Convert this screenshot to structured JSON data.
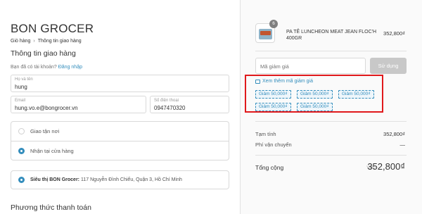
{
  "brand": "BON GROCER",
  "breadcrumb": {
    "cart": "Giỏ hàng",
    "separator": "›",
    "current": "Thông tin giao hàng"
  },
  "shipping": {
    "title": "Thông tin giao hàng",
    "have_account": "Bạn đã có tài khoản?",
    "login_link": "Đăng nhập",
    "name_label": "Họ và tên",
    "name_value": "hung",
    "email_label": "Email",
    "email_value": "hung.vo.e@bongrocer.vn",
    "phone_label": "Số điện thoại",
    "phone_value": "0947470320"
  },
  "delivery": {
    "options": [
      {
        "label": "Giao tận nơi",
        "selected": false
      },
      {
        "label": "Nhận tại cửa hàng",
        "selected": true
      }
    ],
    "store_name": "Siêu thị BON Grocer:",
    "store_address": "117 Nguyễn Đình Chiểu, Quận 3, Hồ Chí Minh"
  },
  "payment": {
    "title": "Phương thức thanh toán"
  },
  "order": {
    "product_name": "PA TÊ LUNCHEON MEAT JEAN FLOC'H 400GR",
    "product_qty": "6",
    "product_price": "352,800₫",
    "coupon_placeholder": "Mã giảm giá",
    "coupon_button": "Sử dụng",
    "view_more": "Xem thêm mã giảm giá",
    "coupons": [
      "Giảm 50,000₫",
      "Giảm 50,000₫",
      "Giảm 50,000₫",
      "Giảm 50,000₫",
      "Giảm 50,000₫"
    ],
    "subtotal_label": "Tạm tính",
    "subtotal_value": "352,800₫",
    "shipping_label": "Phí vận chuyển",
    "shipping_value": "—",
    "total_label": "Tổng cộng",
    "total_currency": "VND",
    "total_value": "352,800₫"
  },
  "colors": {
    "accent": "#338dbc",
    "highlight": "#e0191c",
    "button_disabled": "#c8c8c8"
  }
}
